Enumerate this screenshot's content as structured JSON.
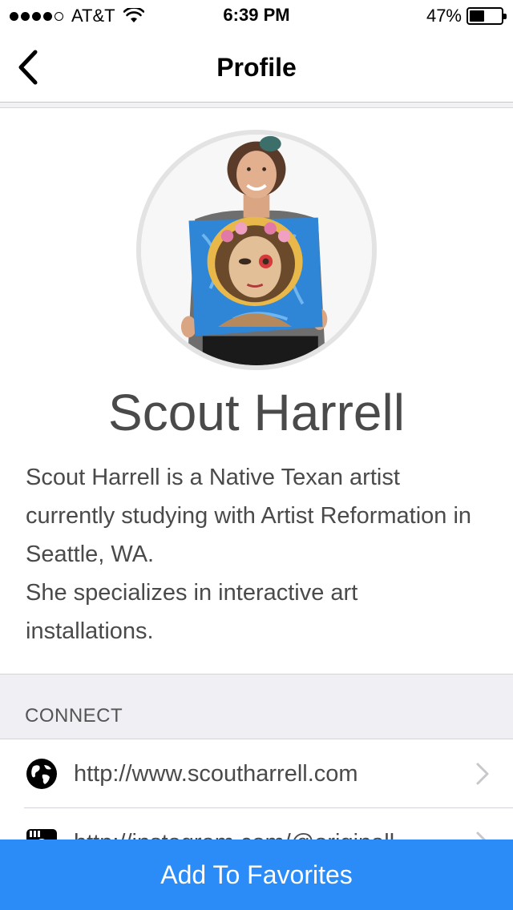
{
  "status_bar": {
    "carrier": "AT&T",
    "signal_bars_filled": 4,
    "signal_bars_total": 5,
    "time": "6:39 PM",
    "battery_percent_label": "47%",
    "battery_level": 0.47
  },
  "nav": {
    "title": "Profile",
    "back_icon": "chevron-left-icon"
  },
  "profile": {
    "name": "Scout Harrell",
    "bio": "Scout Harrell is a Native Texan artist currently studying with Artist Reformation in Seattle, WA.\nShe specializes in interactive art installations."
  },
  "connect": {
    "label": "CONNECT",
    "links": [
      {
        "icon": "globe-icon",
        "text": "http://www.scoutharrell.com"
      },
      {
        "icon": "instagram-icon",
        "text": "http://instagram.com/@originall"
      }
    ]
  },
  "favorites_button": {
    "label": "Add To Favorites"
  },
  "colors": {
    "accent": "#2b8cf7",
    "section_bg": "#efeff4",
    "text_gray": "#4a4a4a"
  }
}
